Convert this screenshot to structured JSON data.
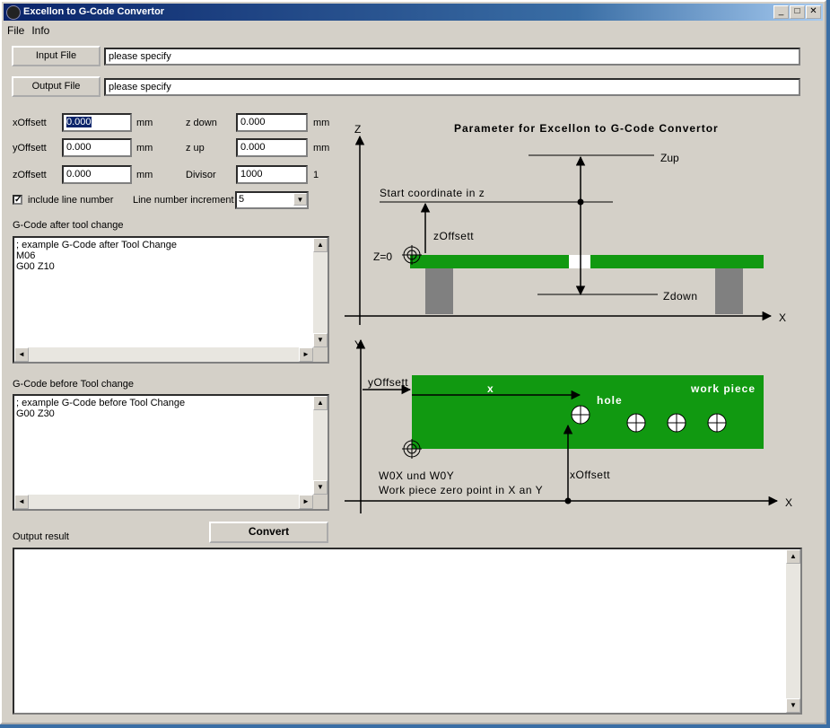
{
  "window": {
    "title": "Excellon to G-Code Convertor",
    "buttons": {
      "minimize": "_",
      "maximize": "□",
      "close": "✕"
    }
  },
  "menu": {
    "items": [
      "File",
      "Info"
    ]
  },
  "files": {
    "input_label": "Input File",
    "input_value": "please specify",
    "output_label": "Output File",
    "output_value": "please specify"
  },
  "params": {
    "xoffset": {
      "label": "xOffsett",
      "value": "0.000",
      "unit": "mm"
    },
    "yoffset": {
      "label": "yOffsett",
      "value": "0.000",
      "unit": "mm"
    },
    "zoffset": {
      "label": "zOffsett",
      "value": "0.000",
      "unit": "mm"
    },
    "zdown": {
      "label": "z  down",
      "value": "0.000",
      "unit": "mm"
    },
    "zup": {
      "label": "z up",
      "value": "0.000",
      "unit": "mm"
    },
    "divisor": {
      "label": "Divisor",
      "value": "1000",
      "unit": "1"
    }
  },
  "line_numbers": {
    "checkbox_label": "include line number",
    "checked": true,
    "increment_label": "Line number increment",
    "increment_value": "5"
  },
  "gcode_after": {
    "label": "G-Code after tool change",
    "text": "; example G-Code after Tool Change\nM06\nG00 Z10"
  },
  "gcode_before": {
    "label": "G-Code before Tool change",
    "text": "; example G-Code before Tool Change\nG00 Z30"
  },
  "convert_label": "Convert",
  "output_label": "Output result",
  "diagram": {
    "title": "Parameter for Excellon to G-Code Convertor",
    "top": {
      "z_axis": "Z",
      "x_axis": "X",
      "zup": "Zup",
      "start_coord": "Start coordinate in z",
      "zoffset": "zOffsett",
      "z0": "Z=0",
      "zdown": "Zdown"
    },
    "bottom": {
      "y_axis": "Y",
      "x_axis": "X",
      "yoffset": "yOffsett",
      "x": "x",
      "hole": "hole",
      "workpiece": "work piece",
      "w0": "W0X und W0Y",
      "w0_desc": "Work piece zero point in X an Y",
      "xoffset": "xOffsett"
    },
    "colors": {
      "board": "#119911",
      "support": "#808080"
    }
  },
  "scroll_glyphs": {
    "up": "▲",
    "down": "▼",
    "left": "◄",
    "right": "►",
    "check": "✓"
  }
}
